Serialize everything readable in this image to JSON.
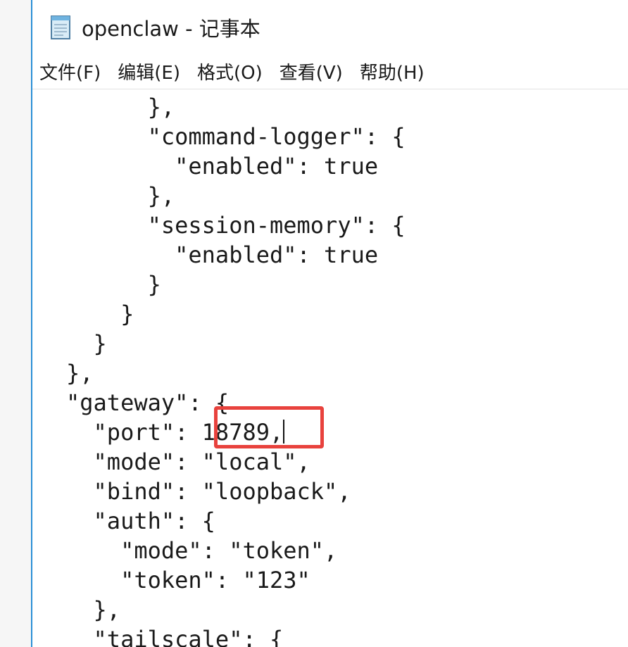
{
  "window": {
    "title": "openclaw - 记事本"
  },
  "menu": {
    "items": [
      "文件(F)",
      "编辑(E)",
      "格式(O)",
      "查看(V)",
      "帮助(H)"
    ]
  },
  "editor": {
    "lines": [
      "      },",
      "      \"command-logger\": {",
      "        \"enabled\": true",
      "      },",
      "      \"session-memory\": {",
      "        \"enabled\": true",
      "      }",
      "    }",
      "  }",
      "},",
      "\"gateway\": {",
      "  \"port\": 18789,",
      "  \"mode\": \"local\",",
      "  \"bind\": \"loopback\",",
      "  \"auth\": {",
      "    \"mode\": \"token\",",
      "    \"token\": \"123\"",
      "  },",
      "  \"tailscale\": {"
    ]
  },
  "colors": {
    "accent_border": "#2b8fd6",
    "highlight": "#e8423d"
  },
  "icons": {
    "app": "notepad-icon"
  }
}
